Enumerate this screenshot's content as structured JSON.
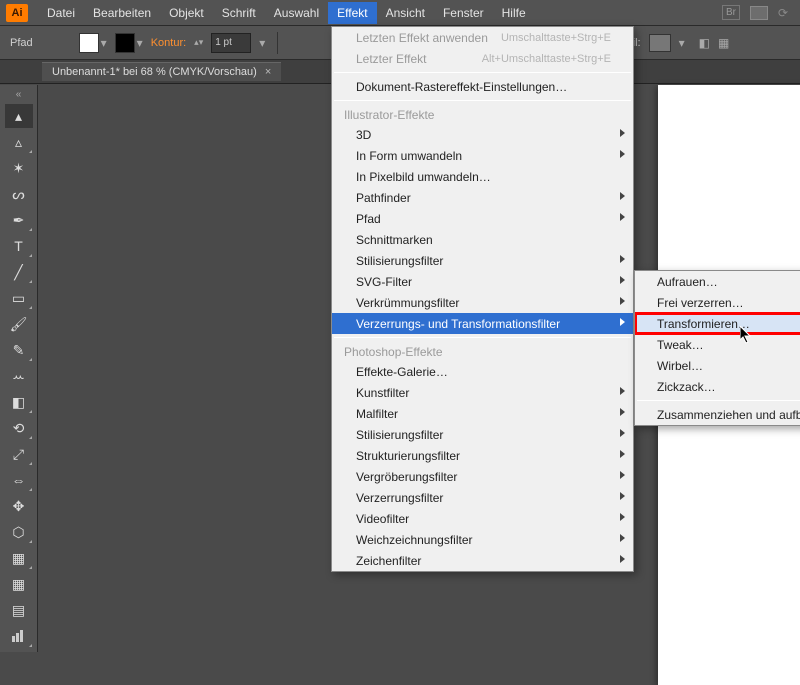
{
  "app": {
    "logo": "Ai"
  },
  "menubar": {
    "items": [
      "Datei",
      "Bearbeiten",
      "Objekt",
      "Schrift",
      "Auswahl",
      "Effekt",
      "Ansicht",
      "Fenster",
      "Hilfe"
    ],
    "open_index": 5
  },
  "optionsbar": {
    "shape_label": "Pfad",
    "kontur_label": "Kontur:",
    "stroke_value": "1 pt",
    "stil_label": "Stil:"
  },
  "doc_tab": {
    "title": "Unbenannt-1* bei 68 % (CMYK/Vorschau)"
  },
  "effect_menu": {
    "apply_last": "Letzten Effekt anwenden",
    "apply_last_shortcut": "Umschalttaste+Strg+E",
    "last_effect": "Letzter Effekt",
    "last_effect_shortcut": "Alt+Umschalttaste+Strg+E",
    "doc_raster": "Dokument-Rastereffekt-Einstellungen…",
    "header1": "Illustrator-Effekte",
    "group1": [
      "3D",
      "In Form umwandeln",
      "In Pixelbild umwandeln…",
      "Pathfinder",
      "Pfad",
      "Schnittmarken",
      "Stilisierungsfilter",
      "SVG-Filter",
      "Verkrümmungsfilter",
      "Verzerrungs- und Transformationsfilter"
    ],
    "group1_submenu_flags": [
      true,
      true,
      false,
      true,
      true,
      false,
      true,
      true,
      true,
      true
    ],
    "group1_highlight_index": 9,
    "header2": "Photoshop-Effekte",
    "group2": [
      "Effekte-Galerie…",
      "Kunstfilter",
      "Malfilter",
      "Stilisierungsfilter",
      "Strukturierungsfilter",
      "Vergröberungsfilter",
      "Verzerrungsfilter",
      "Videofilter",
      "Weichzeichnungsfilter",
      "Zeichenfilter"
    ],
    "group2_submenu_flags": [
      false,
      true,
      true,
      true,
      true,
      true,
      true,
      true,
      true,
      true
    ]
  },
  "submenu": {
    "items": [
      "Aufrauen…",
      "Frei verzerren…",
      "Transformieren…",
      "Tweak…",
      "Wirbel…",
      "Zickzack…",
      "",
      "Zusammenziehen und aufblasen…"
    ],
    "highlight_index": 2,
    "sep_indices": [
      6
    ]
  },
  "tools": [
    "sel",
    "dsel",
    "wand",
    "lasso",
    "pen",
    "type",
    "line",
    "rect",
    "brush",
    "pencil",
    "blob",
    "eraser",
    "rotate",
    "scale",
    "width",
    "freetrans",
    "shapebuild",
    "persp",
    "mesh",
    "grad",
    "eyedrop",
    "blend",
    "symbol",
    "graph",
    "artboard",
    "slice"
  ]
}
